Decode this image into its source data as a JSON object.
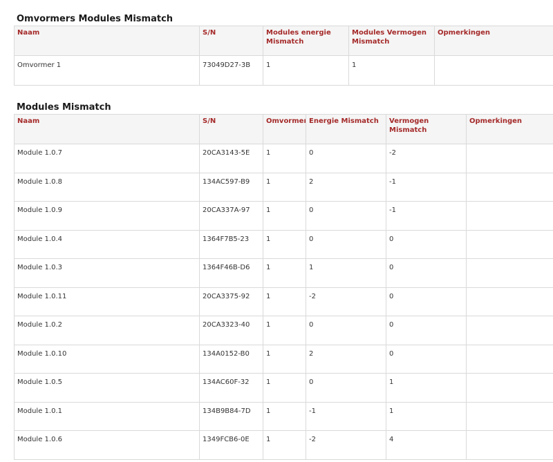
{
  "sections": [
    {
      "title": "Omvormers Modules Mismatch",
      "headers": [
        "Naam",
        "S/N",
        "Modules energie Mismatch",
        "Modules Vermogen Mismatch",
        "Opmerkingen"
      ],
      "rows": [
        [
          "Omvormer 1",
          "73049D27-3B",
          "1",
          "1",
          ""
        ]
      ]
    },
    {
      "title": "Modules Mismatch",
      "headers": [
        "Naam",
        "S/N",
        "Omvormer",
        "Energie Mismatch",
        "Vermogen Mismatch",
        "Opmerkingen"
      ],
      "rows": [
        [
          "Module 1.0.7",
          "20CA3143-5E",
          "1",
          "0",
          "-2",
          ""
        ],
        [
          "Module 1.0.8",
          "134AC597-B9",
          "1",
          "2",
          "-1",
          ""
        ],
        [
          "Module 1.0.9",
          "20CA337A-97",
          "1",
          "0",
          "-1",
          ""
        ],
        [
          "Module 1.0.4",
          "1364F7B5-23",
          "1",
          "0",
          "0",
          ""
        ],
        [
          "Module 1.0.3",
          "1364F46B-D6",
          "1",
          "1",
          "0",
          ""
        ],
        [
          "Module 1.0.11",
          "20CA3375-92",
          "1",
          "-2",
          "0",
          ""
        ],
        [
          "Module 1.0.2",
          "20CA3323-40",
          "1",
          "0",
          "0",
          ""
        ],
        [
          "Module 1.0.10",
          "134A0152-B0",
          "1",
          "2",
          "0",
          ""
        ],
        [
          "Module 1.0.5",
          "134AC60F-32",
          "1",
          "0",
          "1",
          ""
        ],
        [
          "Module 1.0.1",
          "134B9B84-7D",
          "1",
          "-1",
          "1",
          ""
        ],
        [
          "Module 1.0.6",
          "1349FCB6-0E",
          "1",
          "-2",
          "4",
          ""
        ]
      ]
    }
  ]
}
